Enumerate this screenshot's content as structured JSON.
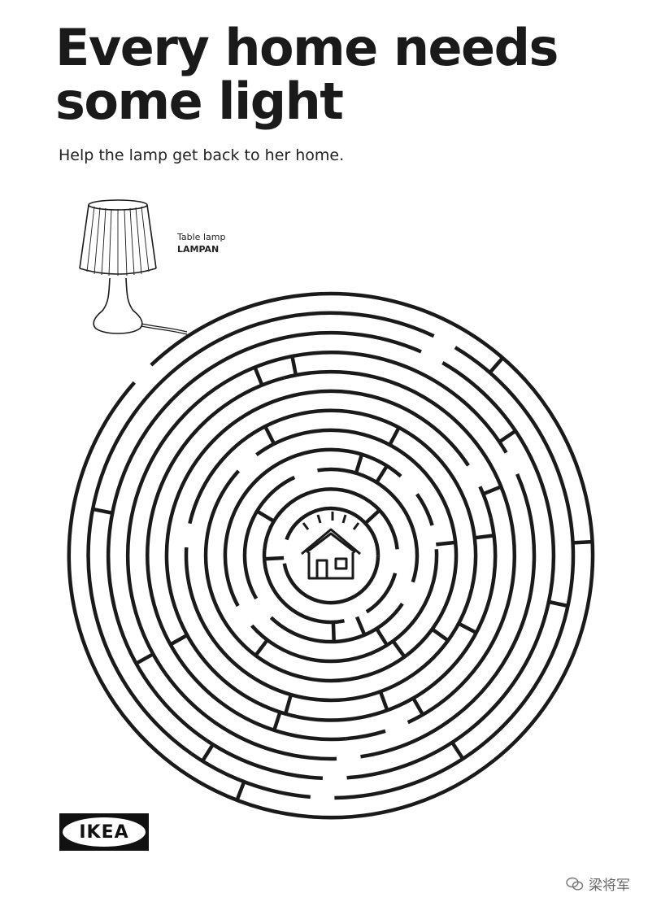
{
  "poster": {
    "title_lines": [
      "Every home needs",
      "some light"
    ],
    "subtitle": "Help the lamp get back to her home.",
    "product": {
      "type": "Table lamp",
      "name": "LAMPAN"
    },
    "brand": "IKEA",
    "watermark": "梁将军"
  },
  "icons": {
    "lamp": "table-lamp-icon",
    "goal": "house-icon",
    "watermark": "wechat-icon"
  },
  "colors": {
    "ink": "#1a1a1a",
    "background": "#ffffff",
    "logo_bg": "#111111"
  }
}
